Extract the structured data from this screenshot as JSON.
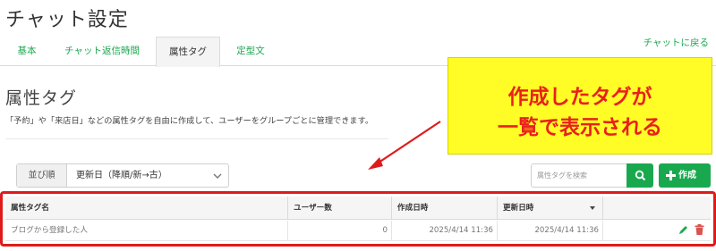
{
  "header": {
    "title": "チャット設定"
  },
  "tabs": [
    {
      "label": "基本"
    },
    {
      "label": "チャット返信時間"
    },
    {
      "label": "属性タグ"
    },
    {
      "label": "定型文"
    }
  ],
  "back_link": "チャットに戻る",
  "section": {
    "title": "属性タグ",
    "description": "「予約」や「来店日」などの属性タグを自由に作成して、ユーザーをグループごとに管理できます。"
  },
  "callout": {
    "line1": "作成したタグが",
    "line2": "一覧で表示される",
    "colors": {
      "background": "#fffc26",
      "text": "#e8211a",
      "arrow": "#e01a1a"
    }
  },
  "sort": {
    "label": "並び順",
    "value": "更新日（降順/新→古）"
  },
  "search": {
    "placeholder": "属性タグを検索"
  },
  "create_button": {
    "label": "作成"
  },
  "table": {
    "columns": [
      "属性タグ名",
      "ユーザー数",
      "作成日時",
      "更新日時"
    ],
    "sorted_column": "更新日時",
    "rows": [
      {
        "name": "ブログから登録した人",
        "users": "0",
        "created": "2025/4/14 11:36",
        "updated": "2025/4/14 11:36"
      }
    ]
  },
  "colors": {
    "accent": "#1aa84f",
    "highlight_frame": "#e01a1a"
  }
}
